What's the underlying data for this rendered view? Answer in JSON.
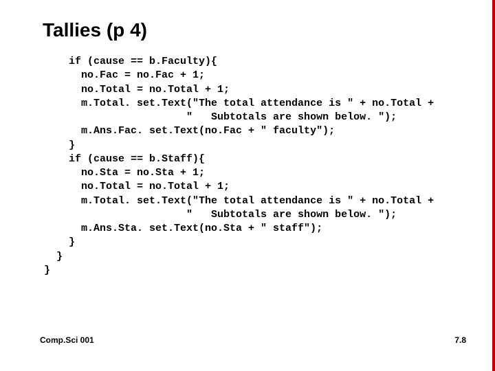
{
  "title": "Tallies (p 4)",
  "code_lines": [
    "    if (cause == b.Faculty){",
    "      no.Fac = no.Fac + 1;",
    "      no.Total = no.Total + 1;",
    "      m.Total. set.Text(\"The total attendance is \" + no.Total +",
    "                       \"   Subtotals are shown below. \");",
    "      m.Ans.Fac. set.Text(no.Fac + \" faculty\");",
    "    }",
    "    if (cause == b.Staff){",
    "      no.Sta = no.Sta + 1;",
    "      no.Total = no.Total + 1;",
    "      m.Total. set.Text(\"The total attendance is \" + no.Total +",
    "                       \"   Subtotals are shown below. \");",
    "      m.Ans.Sta. set.Text(no.Sta + \" staff\");",
    "    }",
    "  }",
    "}"
  ],
  "footer": {
    "left": "Comp.Sci 001",
    "right": "7.8"
  }
}
